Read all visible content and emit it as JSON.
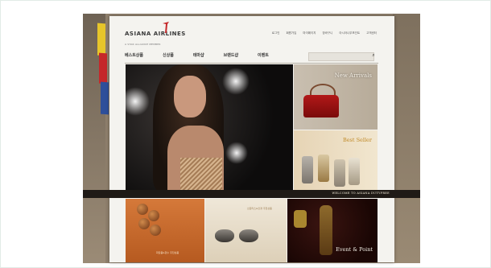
{
  "site": {
    "brand": "ASIANA AIRLINES",
    "alliance": "A STAR ALLIANCE MEMBER"
  },
  "util_links": [
    "로그인",
    "회원가입",
    "마이페이지",
    "장바구니",
    "아시아나우포인트",
    "고객센터"
  ],
  "nav": [
    "베스트상품",
    "신상품",
    "테마샵",
    "브랜드샵",
    "이벤트"
  ],
  "search": {
    "placeholder": ""
  },
  "tiles": {
    "new_arrivals": "New Arrivals",
    "best_seller": "Best Seller",
    "event_point": "Event & Point",
    "glasses_sub": "선글라스&안경 추천상품",
    "cosmetics_sub": "화장품&향수 추천상품"
  },
  "banner": "WELCOME TO ASIANA DUTYFREE",
  "colors": {
    "brand_red": "#c5282a",
    "accent_gold": "#c08a28"
  }
}
